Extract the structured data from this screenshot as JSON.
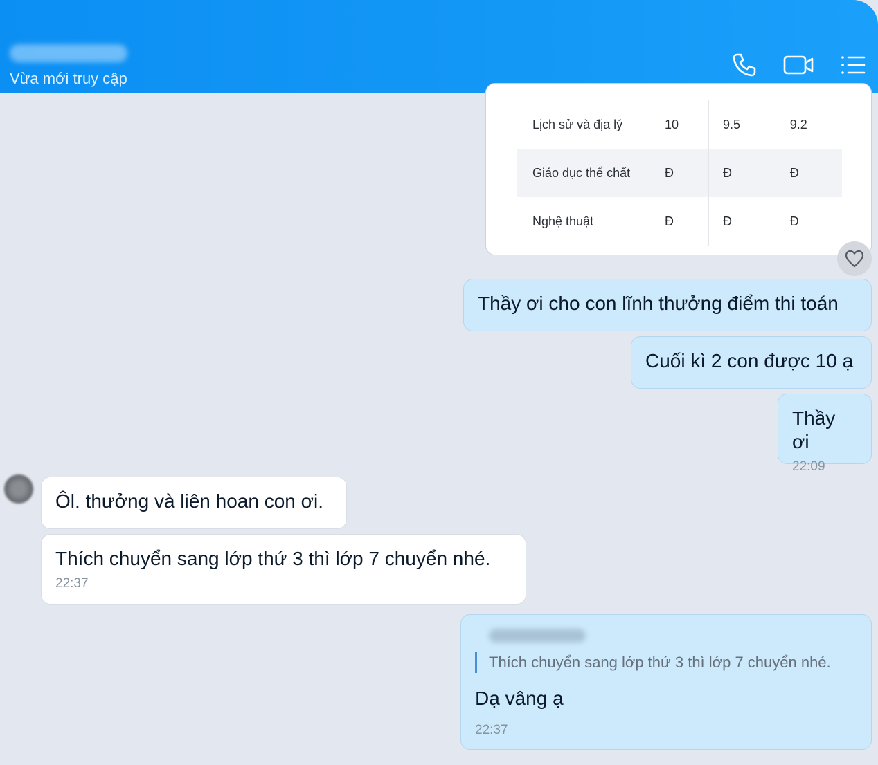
{
  "header": {
    "contact_name": "",
    "status": "Vừa mới truy cập",
    "icons": [
      "phone-icon",
      "video-call-icon",
      "menu-list-icon"
    ]
  },
  "report_card": {
    "rows": [
      {
        "subject": "Lịch sử và địa lý",
        "s1": "10",
        "s2": "9.5",
        "s3": "9.2"
      },
      {
        "subject": "Giáo dục thể chất",
        "s1": "Đ",
        "s2": "Đ",
        "s3": "Đ"
      },
      {
        "subject": "Nghệ thuật",
        "s1": "Đ",
        "s2": "Đ",
        "s3": "Đ"
      }
    ]
  },
  "messages": {
    "m1": "Thầy ơi cho con lĩnh thưởng điểm thi toán",
    "m2": "Cuối kì 2 con được 10 ạ",
    "m3": "Thầy ơi",
    "m3_time": "22:09",
    "m4": "Ôl. thưởng và liên hoan con ơi.",
    "m5": "Thích chuyển sang lớp thứ 3 thì lớp 7 chuyển nhé.",
    "m5_time": "22:37",
    "m6_quote": "Thích chuyển sang lớp thứ 3 thì lớp 7 chuyển nhé.",
    "m6": "Dạ vâng ạ",
    "m6_time": "22:37"
  },
  "colors": {
    "header": "#1498f6",
    "outgoing_bubble": "#cdeafc",
    "incoming_bubble": "#ffffff",
    "background": "#e3e7ef"
  }
}
